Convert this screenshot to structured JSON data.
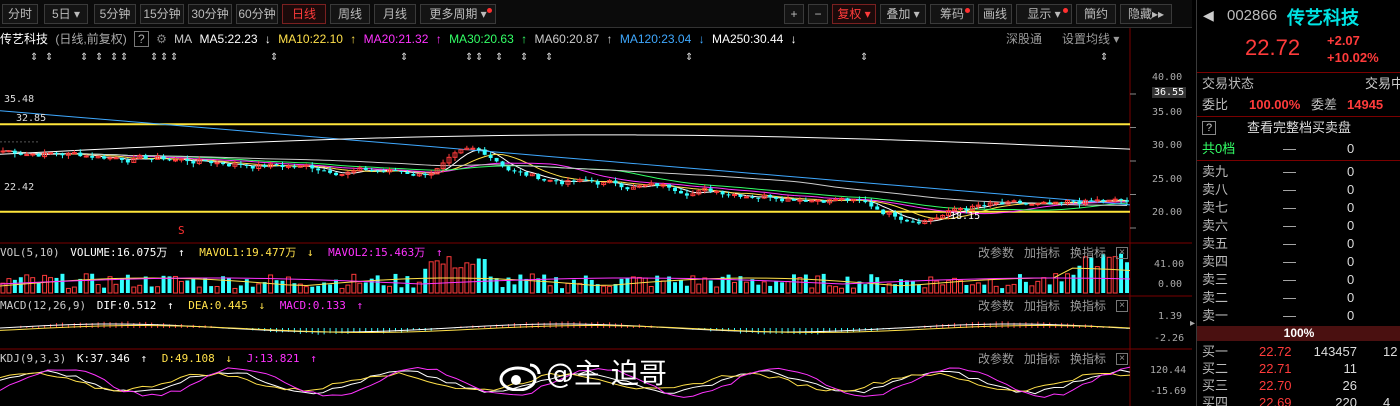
{
  "toolbar": {
    "periods": [
      "分时",
      "5日",
      "5分钟",
      "15分钟",
      "30分钟",
      "60分钟",
      "日线",
      "周线",
      "月线",
      "更多周期"
    ],
    "active": "日线",
    "right": [
      "+",
      "−",
      "复权",
      "叠加",
      "筹码",
      "画线",
      "显示",
      "簡约",
      "隐藏"
    ],
    "active_right": "复权",
    "scroll_arrow": "▸▸"
  },
  "legend": {
    "stock_title": "传艺科技",
    "mode": "(日线,前复权)",
    "help": "?",
    "ma": [
      "MA",
      "MA5:22.23",
      "MA10:22.10",
      "MA20:21.32",
      "MA30:20.63",
      "MA60:20.87",
      "MA120:23.04",
      "MA250:30.44"
    ],
    "ma_colors": [
      "#cccccc",
      "#ffffff",
      "#ffe04a",
      "#ff33ff",
      "#33ff66",
      "#cccccc",
      "#3fa9ff",
      "#ffffff"
    ],
    "deep_link": "深股通",
    "settings": "设置均线"
  },
  "price_axis": {
    "ticks": [
      "40.00",
      "35.00",
      "30.00",
      "25.00",
      "20.00"
    ],
    "marker": "36.55"
  },
  "price_levels": [
    {
      "label": "35.48",
      "value": 35.48
    },
    {
      "label": "32.85",
      "value": 32.85
    },
    {
      "label": "22.42",
      "value": 22.42
    }
  ],
  "vol": {
    "legend": [
      "VOL(5,10)",
      "VOLUME:16.075万",
      "MAVOL1:19.477万",
      "MAVOL2:15.463万"
    ],
    "colors": [
      "#cccccc",
      "#ffffff",
      "#ffe04a",
      "#ff33ff"
    ],
    "arrows": [
      "↑",
      "↓",
      "↑"
    ],
    "ticks": [
      "41.00",
      "0.00"
    ]
  },
  "macd": {
    "legend": [
      "MACD(12,26,9)",
      "DIF:0.512",
      "DEA:0.445",
      "MACD:0.133"
    ],
    "colors": [
      "#cccccc",
      "#ffffff",
      "#ffe04a",
      "#ff33ff"
    ],
    "arrows": [
      "↑",
      "↓",
      "↑"
    ],
    "ticks": [
      "1.39",
      "-2.26"
    ]
  },
  "kdj": {
    "legend": [
      "KDJ(9,3,3)",
      "K:37.346",
      "D:49.108",
      "J:13.821"
    ],
    "colors": [
      "#cccccc",
      "#ffffff",
      "#ffe04a",
      "#ff33ff"
    ],
    "arrows": [
      "↑",
      "↓",
      "↑"
    ],
    "ticks": [
      "120.44",
      "-15.69"
    ]
  },
  "pane_buttons": [
    "改参数",
    "加指标",
    "换指标"
  ],
  "close_glyph": "×",
  "sell_marker": "S",
  "low_annotation": "18.15",
  "watermark": "@主 迫哥",
  "quote": {
    "code": "002866",
    "name": "传艺科技",
    "price": "22.72",
    "change": "+2.07",
    "pct": "+10.02%",
    "status_label": "交易状态",
    "status_value": "交易中",
    "weibi_label": "委比",
    "weibi": "100.00%",
    "weicha_label": "委差",
    "weicha": "14945",
    "full_book": "查看完整档买卖盘",
    "total_label": "共0档",
    "total_dash": "—",
    "total_zero": "0",
    "asks": [
      {
        "label": "卖九",
        "price": "—",
        "vol": "0"
      },
      {
        "label": "卖八",
        "price": "—",
        "vol": "0"
      },
      {
        "label": "卖七",
        "price": "—",
        "vol": "0"
      },
      {
        "label": "卖六",
        "price": "—",
        "vol": "0"
      },
      {
        "label": "卖五",
        "price": "—",
        "vol": "0"
      },
      {
        "label": "卖四",
        "price": "—",
        "vol": "0"
      },
      {
        "label": "卖三",
        "price": "—",
        "vol": "0"
      },
      {
        "label": "卖二",
        "price": "—",
        "vol": "0"
      },
      {
        "label": "卖一",
        "price": "—",
        "vol": "0"
      }
    ],
    "mid_pct": "100%",
    "bids": [
      {
        "label": "买一",
        "price": "22.72",
        "vol": "143457",
        "extra": "12"
      },
      {
        "label": "买二",
        "price": "22.71",
        "vol": "11",
        "extra": ""
      },
      {
        "label": "买三",
        "price": "22.70",
        "vol": "26",
        "extra": ""
      },
      {
        "label": "买四",
        "price": "22.69",
        "vol": "220",
        "extra": "4"
      }
    ]
  },
  "colors": {
    "up": "#ff3b3b",
    "down": "#33ffff",
    "price": "#ff3b3b",
    "name": "#00e5e5",
    "level": "#ffe53b",
    "border": "#7a0000"
  }
}
